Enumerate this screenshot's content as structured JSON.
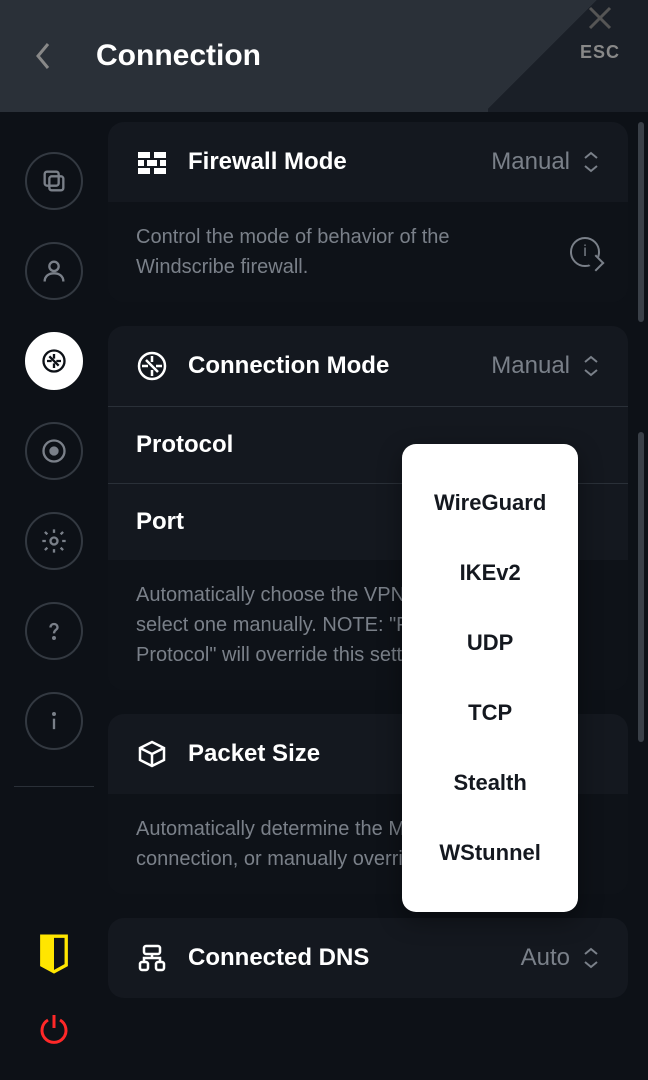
{
  "header": {
    "title": "Connection",
    "esc_label": "ESC"
  },
  "cards": {
    "firewall": {
      "title": "Firewall Mode",
      "value": "Manual",
      "description": "Control the mode of behavior of the Windscribe firewall."
    },
    "connection": {
      "title": "Connection Mode",
      "value": "Manual",
      "protocol_label": "Protocol",
      "port_label": "Port",
      "description": "Automatically choose the VPN protocol, or select one manually. NOTE: \"Preferred Protocol\" will override this setting."
    },
    "packet": {
      "title": "Packet Size",
      "description": "Automatically determine the MTU for your connection, or manually override."
    },
    "dns": {
      "title": "Connected DNS",
      "value": "Auto"
    }
  },
  "dropdown": {
    "options": [
      "WireGuard",
      "IKEv2",
      "UDP",
      "TCP",
      "Stealth",
      "WStunnel"
    ]
  }
}
